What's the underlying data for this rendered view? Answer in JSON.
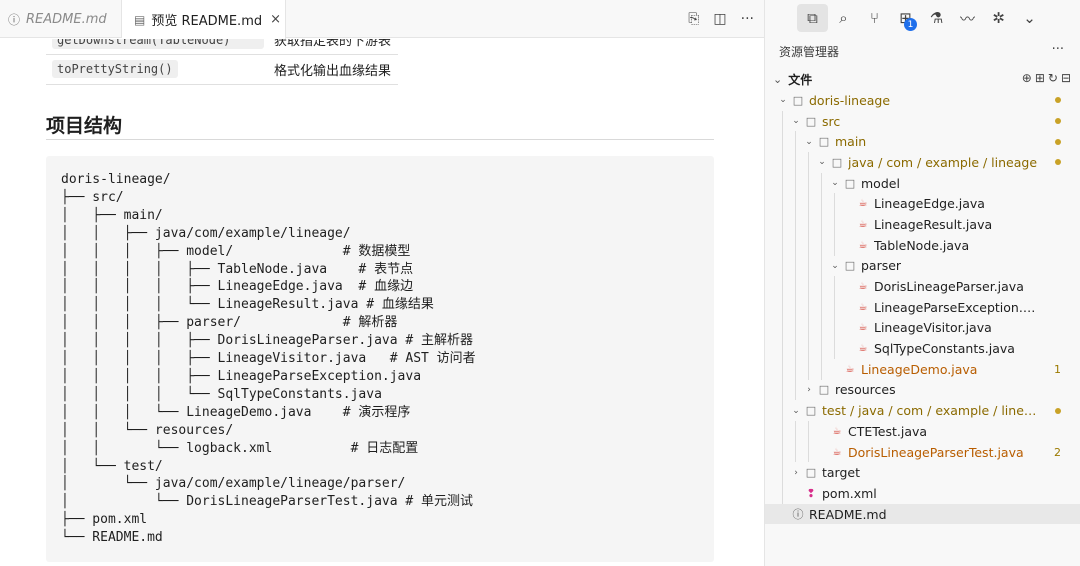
{
  "tabs": {
    "readme": {
      "icon": "ⓘ",
      "label": "README.md"
    },
    "preview": {
      "icon": "▤",
      "label": "预览 README.md",
      "close": "×"
    }
  },
  "editor_actions": {
    "split": "⎘",
    "layout": "◫",
    "more": "···"
  },
  "preview": {
    "methods": [
      {
        "code": "getDownstream(TableNode)",
        "desc": "获取指定表的下游表"
      },
      {
        "code": "toPrettyString()",
        "desc": "格式化输出血缘结果"
      }
    ],
    "section_title": "项目结构",
    "code_lines": [
      "doris-lineage/",
      "├── src/",
      "│   ├── main/",
      "│   │   ├── java/com/example/lineage/",
      "│   │   │   ├── model/              # 数据模型",
      "│   │   │   │   ├── TableNode.java    # 表节点",
      "│   │   │   │   ├── LineageEdge.java  # 血缘边",
      "│   │   │   │   └── LineageResult.java # 血缘结果",
      "│   │   │   ├── parser/             # 解析器",
      "│   │   │   │   ├── DorisLineageParser.java # 主解析器",
      "│   │   │   │   ├── LineageVisitor.java   # AST 访问者",
      "│   │   │   │   ├── LineageParseException.java",
      "│   │   │   │   └── SqlTypeConstants.java",
      "│   │   │   └── LineageDemo.java    # 演示程序",
      "│   │   └── resources/",
      "│   │       └── logback.xml          # 日志配置",
      "│   └── test/",
      "│       └── java/com/example/lineage/parser/",
      "│           └── DorisLineageParserTest.java # 单元测试",
      "├── pom.xml",
      "└── README.md"
    ]
  },
  "sidebar": {
    "activity": [
      {
        "name": "explorer-icon",
        "glyph": "⧉",
        "active": true
      },
      {
        "name": "search-icon",
        "glyph": "⌕"
      },
      {
        "name": "source-control-icon",
        "glyph": "⑂"
      },
      {
        "name": "extensions-icon",
        "glyph": "⊞",
        "badge": "1"
      },
      {
        "name": "testing-icon",
        "glyph": "⚗"
      },
      {
        "name": "remote-icon",
        "glyph": "〰"
      },
      {
        "name": "debug-icon",
        "glyph": "✲"
      },
      {
        "name": "chevron-down-icon",
        "glyph": "⌄"
      }
    ],
    "title": "资源管理器",
    "more": "···",
    "files_header": "文件",
    "files_actions": "⊕⊞↻⊟",
    "tree": [
      {
        "depth": 0,
        "chev": "⌄",
        "icon": "folder",
        "label": "doris-lineage",
        "state": "mod",
        "dot": true
      },
      {
        "depth": 1,
        "chev": "⌄",
        "icon": "folder",
        "label": "src",
        "state": "mod",
        "dot": true
      },
      {
        "depth": 2,
        "chev": "⌄",
        "icon": "folder",
        "label": "main",
        "state": "mod",
        "dot": true
      },
      {
        "depth": 3,
        "chev": "⌄",
        "icon": "folder",
        "label": "java / com / example / lineage",
        "state": "mod",
        "dot": true
      },
      {
        "depth": 4,
        "chev": "⌄",
        "icon": "folder",
        "label": "model",
        "state": ""
      },
      {
        "depth": 5,
        "chev": "",
        "icon": "java",
        "label": "LineageEdge.java",
        "state": ""
      },
      {
        "depth": 5,
        "chev": "",
        "icon": "java",
        "label": "LineageResult.java",
        "state": ""
      },
      {
        "depth": 5,
        "chev": "",
        "icon": "java",
        "label": "TableNode.java",
        "state": ""
      },
      {
        "depth": 4,
        "chev": "⌄",
        "icon": "folder",
        "label": "parser",
        "state": ""
      },
      {
        "depth": 5,
        "chev": "",
        "icon": "java",
        "label": "DorisLineageParser.java",
        "state": ""
      },
      {
        "depth": 5,
        "chev": "",
        "icon": "java",
        "label": "LineageParseException.java",
        "state": ""
      },
      {
        "depth": 5,
        "chev": "",
        "icon": "java",
        "label": "LineageVisitor.java",
        "state": ""
      },
      {
        "depth": 5,
        "chev": "",
        "icon": "java",
        "label": "SqlTypeConstants.java",
        "state": ""
      },
      {
        "depth": 4,
        "chev": "",
        "icon": "java",
        "label": "LineageDemo.java",
        "state": "err",
        "status": "1"
      },
      {
        "depth": 2,
        "chev": "›",
        "icon": "folder",
        "label": "resources",
        "state": ""
      },
      {
        "depth": 1,
        "chev": "⌄",
        "icon": "folder",
        "label": "test / java / com / example / lineage / p...",
        "state": "mod",
        "dot": true
      },
      {
        "depth": 3,
        "chev": "",
        "icon": "java",
        "label": "CTETest.java",
        "state": ""
      },
      {
        "depth": 3,
        "chev": "",
        "icon": "java",
        "label": "DorisLineageParserTest.java",
        "state": "err",
        "status": "2"
      },
      {
        "depth": 1,
        "chev": "›",
        "icon": "folder",
        "label": "target",
        "state": ""
      },
      {
        "depth": 1,
        "chev": "",
        "icon": "xml",
        "label": "pom.xml",
        "state": ""
      },
      {
        "depth": 0,
        "chev": "",
        "icon": "info",
        "label": "README.md",
        "state": "",
        "selected": true
      }
    ]
  }
}
